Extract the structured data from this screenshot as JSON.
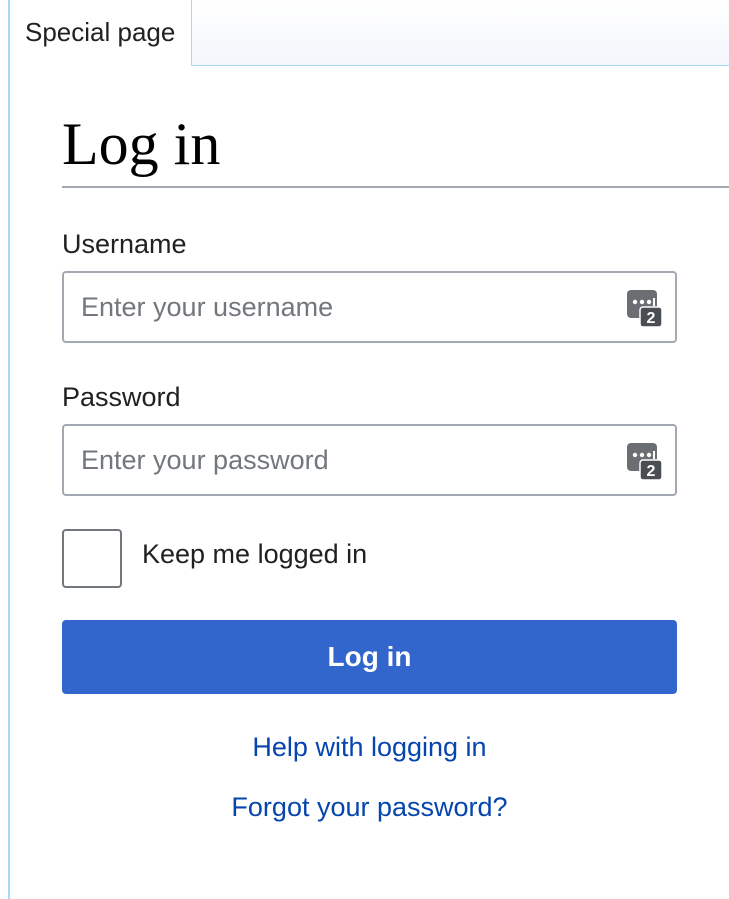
{
  "tabs": {
    "active_label": "Special page"
  },
  "page": {
    "title": "Log in"
  },
  "form": {
    "username": {
      "label": "Username",
      "placeholder": "Enter your username",
      "value": ""
    },
    "password": {
      "label": "Password",
      "placeholder": "Enter your password",
      "value": ""
    },
    "remember": {
      "label": "Keep me logged in",
      "checked": false
    },
    "submit_label": "Log in"
  },
  "links": {
    "help": "Help with logging in",
    "forgot": "Forgot your password?"
  },
  "icons": {
    "field_icon": "password-manager-icon"
  },
  "colors": {
    "primary_button": "#3366cc",
    "link": "#0645ad",
    "border": "#a2a9b1"
  }
}
